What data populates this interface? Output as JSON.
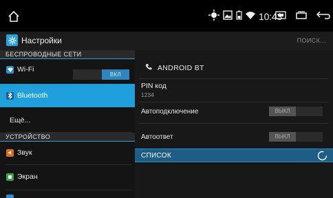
{
  "status_bar": {
    "time": "10:43",
    "icons": [
      "home-icon",
      "location-icon",
      "image-icon",
      "battery-icon",
      "wifi-icon",
      "screenshot-icon",
      "recent-apps-icon",
      "back-icon"
    ]
  },
  "title_bar": {
    "title": "Настройки",
    "search_label": "ПОИСК..."
  },
  "sidebar": {
    "section_wireless": "БЕСПРОВОДНЫЕ СЕТИ",
    "wifi_label": "Wi-Fi",
    "wifi_toggle": "ВКЛ",
    "bluetooth_label": "Bluetooth",
    "more_label": "Ещё...",
    "section_device": "УСТРОЙСТВО",
    "sound_label": "Звук",
    "display_label": "Экран"
  },
  "detail": {
    "device_name": "ANDROID BT",
    "pin_title": "PIN код",
    "pin_value": "1234",
    "autoconnect_label": "Автоподключение",
    "autoconnect_value": "ВЫКЛ",
    "autoanswer_label": "Автоответ",
    "autoanswer_value": "ВЫКЛ",
    "list_label": "СПИСОК"
  },
  "colors": {
    "accent": "#1fa0dc",
    "list_bar": "#1e5d85",
    "background": "#141414"
  }
}
